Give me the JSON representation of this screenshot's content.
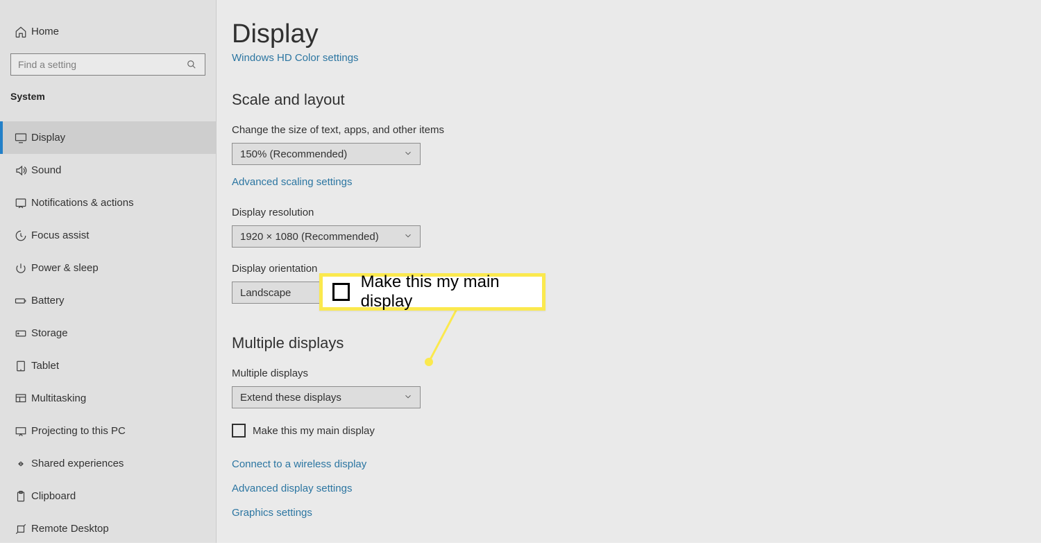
{
  "sidebar": {
    "home": "Home",
    "search_placeholder": "Find a setting",
    "group": "System",
    "items": [
      {
        "label": "Display"
      },
      {
        "label": "Sound"
      },
      {
        "label": "Notifications & actions"
      },
      {
        "label": "Focus assist"
      },
      {
        "label": "Power & sleep"
      },
      {
        "label": "Battery"
      },
      {
        "label": "Storage"
      },
      {
        "label": "Tablet"
      },
      {
        "label": "Multitasking"
      },
      {
        "label": "Projecting to this PC"
      },
      {
        "label": "Shared experiences"
      },
      {
        "label": "Clipboard"
      },
      {
        "label": "Remote Desktop"
      }
    ]
  },
  "main": {
    "title": "Display",
    "clipped_link": "Windows HD Color settings",
    "scale_header": "Scale and layout",
    "scale_label": "Change the size of text, apps, and other items",
    "scale_value": "150% (Recommended)",
    "adv_scaling": "Advanced scaling settings",
    "res_label": "Display resolution",
    "res_value": "1920 × 1080 (Recommended)",
    "orient_label": "Display orientation",
    "orient_value": "Landscape",
    "multi_header": "Multiple displays",
    "multi_label": "Multiple displays",
    "multi_value": "Extend these displays",
    "main_disp_check": "Make this my main display",
    "link_wireless": "Connect to a wireless display",
    "link_adv_disp": "Advanced display settings",
    "link_graphics": "Graphics settings"
  },
  "callout": {
    "text": "Make this my main display"
  }
}
